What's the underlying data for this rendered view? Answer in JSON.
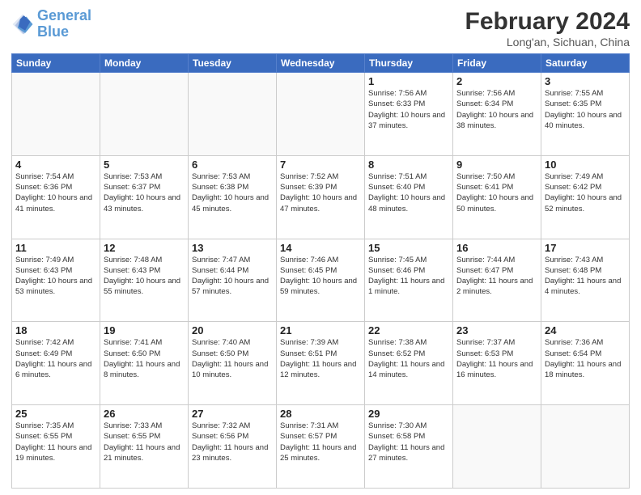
{
  "header": {
    "logo_line1": "General",
    "logo_line2": "Blue",
    "main_title": "February 2024",
    "subtitle": "Long'an, Sichuan, China"
  },
  "weekdays": [
    "Sunday",
    "Monday",
    "Tuesday",
    "Wednesday",
    "Thursday",
    "Friday",
    "Saturday"
  ],
  "weeks": [
    [
      {
        "day": "",
        "info": ""
      },
      {
        "day": "",
        "info": ""
      },
      {
        "day": "",
        "info": ""
      },
      {
        "day": "",
        "info": ""
      },
      {
        "day": "1",
        "info": "Sunrise: 7:56 AM\nSunset: 6:33 PM\nDaylight: 10 hours and 37 minutes."
      },
      {
        "day": "2",
        "info": "Sunrise: 7:56 AM\nSunset: 6:34 PM\nDaylight: 10 hours and 38 minutes."
      },
      {
        "day": "3",
        "info": "Sunrise: 7:55 AM\nSunset: 6:35 PM\nDaylight: 10 hours and 40 minutes."
      }
    ],
    [
      {
        "day": "4",
        "info": "Sunrise: 7:54 AM\nSunset: 6:36 PM\nDaylight: 10 hours and 41 minutes."
      },
      {
        "day": "5",
        "info": "Sunrise: 7:53 AM\nSunset: 6:37 PM\nDaylight: 10 hours and 43 minutes."
      },
      {
        "day": "6",
        "info": "Sunrise: 7:53 AM\nSunset: 6:38 PM\nDaylight: 10 hours and 45 minutes."
      },
      {
        "day": "7",
        "info": "Sunrise: 7:52 AM\nSunset: 6:39 PM\nDaylight: 10 hours and 47 minutes."
      },
      {
        "day": "8",
        "info": "Sunrise: 7:51 AM\nSunset: 6:40 PM\nDaylight: 10 hours and 48 minutes."
      },
      {
        "day": "9",
        "info": "Sunrise: 7:50 AM\nSunset: 6:41 PM\nDaylight: 10 hours and 50 minutes."
      },
      {
        "day": "10",
        "info": "Sunrise: 7:49 AM\nSunset: 6:42 PM\nDaylight: 10 hours and 52 minutes."
      }
    ],
    [
      {
        "day": "11",
        "info": "Sunrise: 7:49 AM\nSunset: 6:43 PM\nDaylight: 10 hours and 53 minutes."
      },
      {
        "day": "12",
        "info": "Sunrise: 7:48 AM\nSunset: 6:43 PM\nDaylight: 10 hours and 55 minutes."
      },
      {
        "day": "13",
        "info": "Sunrise: 7:47 AM\nSunset: 6:44 PM\nDaylight: 10 hours and 57 minutes."
      },
      {
        "day": "14",
        "info": "Sunrise: 7:46 AM\nSunset: 6:45 PM\nDaylight: 10 hours and 59 minutes."
      },
      {
        "day": "15",
        "info": "Sunrise: 7:45 AM\nSunset: 6:46 PM\nDaylight: 11 hours and 1 minute."
      },
      {
        "day": "16",
        "info": "Sunrise: 7:44 AM\nSunset: 6:47 PM\nDaylight: 11 hours and 2 minutes."
      },
      {
        "day": "17",
        "info": "Sunrise: 7:43 AM\nSunset: 6:48 PM\nDaylight: 11 hours and 4 minutes."
      }
    ],
    [
      {
        "day": "18",
        "info": "Sunrise: 7:42 AM\nSunset: 6:49 PM\nDaylight: 11 hours and 6 minutes."
      },
      {
        "day": "19",
        "info": "Sunrise: 7:41 AM\nSunset: 6:50 PM\nDaylight: 11 hours and 8 minutes."
      },
      {
        "day": "20",
        "info": "Sunrise: 7:40 AM\nSunset: 6:50 PM\nDaylight: 11 hours and 10 minutes."
      },
      {
        "day": "21",
        "info": "Sunrise: 7:39 AM\nSunset: 6:51 PM\nDaylight: 11 hours and 12 minutes."
      },
      {
        "day": "22",
        "info": "Sunrise: 7:38 AM\nSunset: 6:52 PM\nDaylight: 11 hours and 14 minutes."
      },
      {
        "day": "23",
        "info": "Sunrise: 7:37 AM\nSunset: 6:53 PM\nDaylight: 11 hours and 16 minutes."
      },
      {
        "day": "24",
        "info": "Sunrise: 7:36 AM\nSunset: 6:54 PM\nDaylight: 11 hours and 18 minutes."
      }
    ],
    [
      {
        "day": "25",
        "info": "Sunrise: 7:35 AM\nSunset: 6:55 PM\nDaylight: 11 hours and 19 minutes."
      },
      {
        "day": "26",
        "info": "Sunrise: 7:33 AM\nSunset: 6:55 PM\nDaylight: 11 hours and 21 minutes."
      },
      {
        "day": "27",
        "info": "Sunrise: 7:32 AM\nSunset: 6:56 PM\nDaylight: 11 hours and 23 minutes."
      },
      {
        "day": "28",
        "info": "Sunrise: 7:31 AM\nSunset: 6:57 PM\nDaylight: 11 hours and 25 minutes."
      },
      {
        "day": "29",
        "info": "Sunrise: 7:30 AM\nSunset: 6:58 PM\nDaylight: 11 hours and 27 minutes."
      },
      {
        "day": "",
        "info": ""
      },
      {
        "day": "",
        "info": ""
      }
    ]
  ]
}
